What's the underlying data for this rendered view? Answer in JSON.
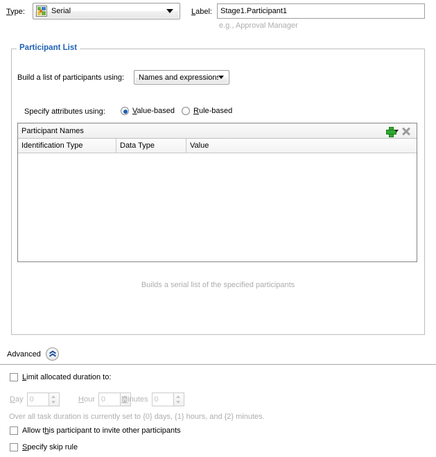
{
  "top": {
    "type_label": "Type:",
    "type_label_mnemonic": "T",
    "type_value": "Serial",
    "type_icon": "serial-flow-icon",
    "label_label": "Label:",
    "label_label_mnemonic": "L",
    "label_value": "Stage1.Participant1",
    "label_hint": "e.g., Approval Manager"
  },
  "participant_list": {
    "title": "Participant List",
    "title_color": "#1f62b5",
    "build_label": "Build a list of participants using:",
    "build_value": "Names and expressions",
    "specify_label": "Specify attributes using:",
    "radios": [
      {
        "label": "Value-based",
        "mnemonic": "V",
        "checked": true
      },
      {
        "label": "Rule-based",
        "mnemonic": "R",
        "checked": false
      }
    ],
    "table": {
      "toolbar_title": "Participant Names",
      "add_icon": "add-plus-icon",
      "add_dropdown_icon": "chevron-down-icon",
      "delete_icon": "delete-x-icon",
      "columns": [
        "Identification Type",
        "Data Type",
        "Value"
      ],
      "rows": []
    },
    "footer_hint": "Builds a serial list of the specified participants"
  },
  "advanced": {
    "label": "Advanced",
    "toggle_icon": "collapse-chevron-up-icon",
    "limit_duration": {
      "label": "Limit allocated duration to:",
      "mnemonic": "L",
      "checked": false
    },
    "duration_fields": [
      {
        "label": "Day",
        "mnemonic": "D",
        "value": "0",
        "disabled": true
      },
      {
        "label": "Hour",
        "mnemonic": "H",
        "value": "0",
        "disabled": true
      },
      {
        "label": "Minutes",
        "mnemonic": "M",
        "value": "0",
        "disabled": true
      }
    ],
    "duration_hint": "Over all task duration is currently set to {0} days, {1} hours, and {2} minutes.",
    "allow_invite": {
      "label": "Allow this participant to invite other participants",
      "mnemonic": "h",
      "checked": false
    },
    "specify_skip": {
      "label": "Specify skip rule",
      "mnemonic": "S",
      "checked": false
    }
  }
}
